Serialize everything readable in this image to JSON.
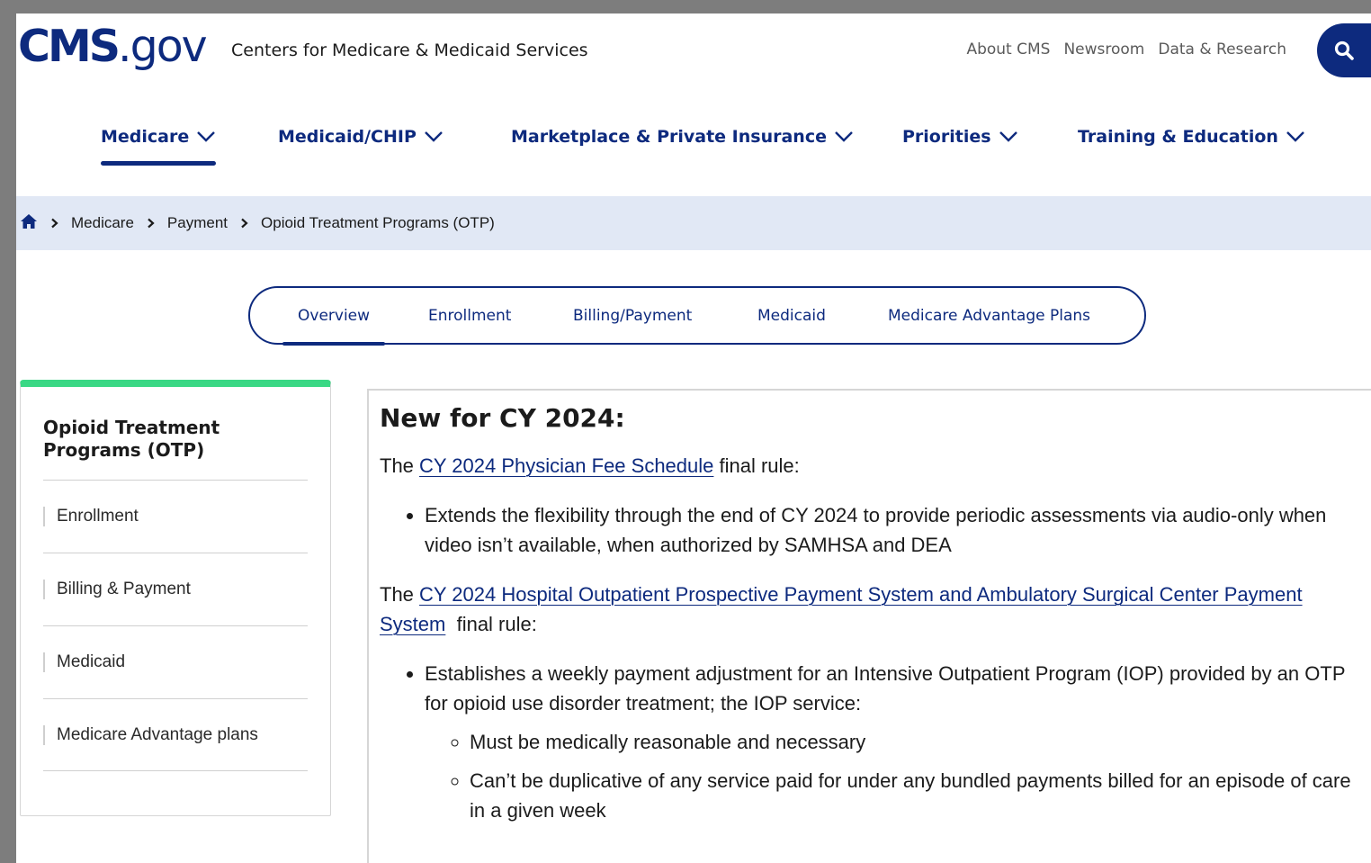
{
  "header": {
    "logo": {
      "cms": "CMS",
      "gov": ".gov"
    },
    "agency": "Centers for Medicare & Medicaid Services",
    "utility_links": [
      "About CMS",
      "Newsroom",
      "Data & Research"
    ],
    "search_icon": "search-icon"
  },
  "main_nav": {
    "items": [
      {
        "label": "Medicare",
        "active": true
      },
      {
        "label": "Medicaid/CHIP",
        "active": false
      },
      {
        "label": "Marketplace & Private Insurance",
        "active": false
      },
      {
        "label": "Priorities",
        "active": false
      },
      {
        "label": "Training & Education",
        "active": false
      }
    ]
  },
  "breadcrumb": {
    "home_icon": "home-icon",
    "items": [
      "Medicare",
      "Payment"
    ],
    "current": "Opioid Treatment Programs (OTP)"
  },
  "tabs": {
    "items": [
      "Overview",
      "Enrollment",
      "Billing/Payment",
      "Medicaid",
      "Medicare Advantage Plans"
    ],
    "active": "Overview"
  },
  "sidebar": {
    "title": "Opioid Treatment Programs (OTP)",
    "items": [
      "Enrollment",
      "Billing & Payment",
      "Medicaid",
      "Medicare Advantage plans"
    ]
  },
  "content": {
    "heading": "New for CY 2024:",
    "p1_prefix": "The ",
    "p1_link": "CY 2024 Physician Fee Schedule",
    "p1_suffix": " final rule:",
    "p1_bullet": "Extends the flexibility through the end of CY 2024 to provide periodic assessments via audio-only when video isn’t available, when authorized by SAMHSA and DEA",
    "p2_prefix": "The ",
    "p2_link": "CY 2024 Hospital Outpatient Prospective Payment System and Ambulatory Surgical Center Payment System",
    "p2_suffix": "  final rule:",
    "p2_bullet": "Establishes a weekly payment adjustment for an Intensive Outpatient Program (IOP) provided by an OTP for opioid use disorder treatment; the IOP service:",
    "p2_sub": [
      "Must be medically reasonable and necessary",
      "Can’t be duplicative of any service paid for under any bundled payments billed for an episode of care in a given week"
    ]
  },
  "colors": {
    "brand_navy": "#0d2a7e",
    "breadcrumb_bg": "#e1e8f5",
    "sidebar_accent": "#3ad885"
  }
}
